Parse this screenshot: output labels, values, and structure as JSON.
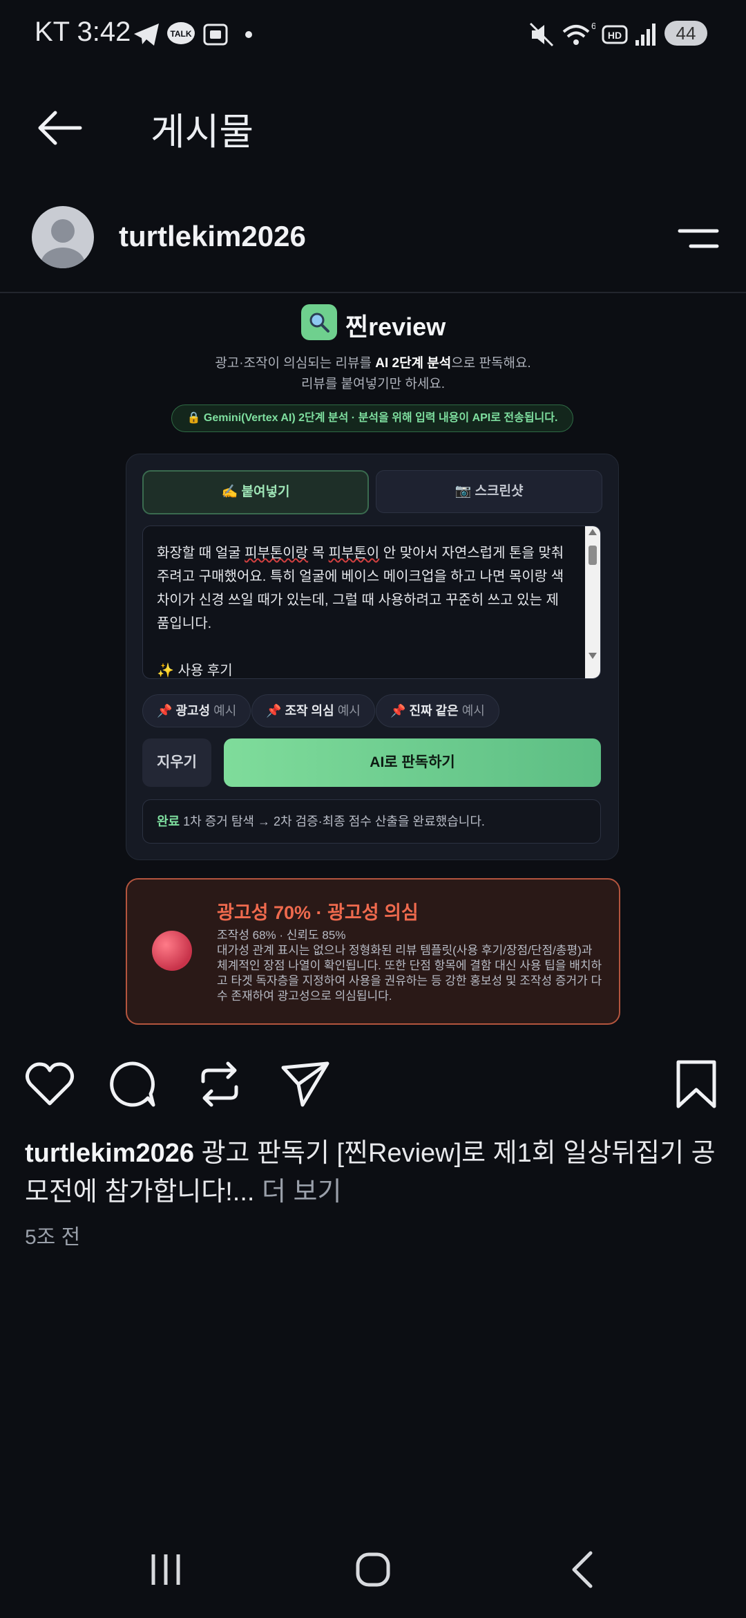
{
  "status_bar": {
    "time": "KT 3:42",
    "battery": "44"
  },
  "header": {
    "title": "게시물"
  },
  "profile": {
    "username": "turtlekim2026"
  },
  "post_image": {
    "logo": "찐review",
    "subtitle_pre": "광고·조작이 의심되는 리뷰를 ",
    "subtitle_bold": "AI 2단계 분석",
    "subtitle_post": "으로 판독해요.",
    "subtitle2": "리뷰를 붙여넣기만 하세요.",
    "notice": "🔒 Gemini(Vertex AI) 2단계 분석 · 분석을 위해 입력 내용이 API로 전송됩니다.",
    "tabs": {
      "paste": "✍️ 붙여넣기",
      "screenshot": "📷 스크린샷"
    },
    "review": {
      "p1": "화장할 때 얼굴 ",
      "w1": "피부톤이랑",
      "p2": " 목 ",
      "w2": "피부톤이",
      "p3": " 안 맞아서 자연스럽게 톤을 맞춰주려고 구매했어요. 특히 얼굴에 베이스 메이크업을 하고 나면 목이랑 색 차이가 신경 쓰일 때가 있는데, 그럴 때 사용하려고 꾸준히 쓰고 있는 제품입니다.",
      "p4": "✨ 사용 후기"
    },
    "chips": [
      {
        "label": "광고성",
        "suffix": "예시"
      },
      {
        "label": "조작 의심",
        "suffix": "예시"
      },
      {
        "label": "진짜 같은",
        "suffix": "예시"
      }
    ],
    "chip_pin": "📌",
    "clear_button": "지우기",
    "judge_button": "AI로 판독하기",
    "done_label": "완료",
    "done_text": " 1차 증거 탐색 → 2차 검증·최종 점수 산출을 완료했습니다.",
    "result": {
      "title": "광고성 70% · 광고성 의심",
      "scores": "조작성 68% · 신뢰도 85%",
      "description": "대가성 관계 표시는 없으나 정형화된 리뷰 템플릿(사용 후기/장점/단점/총평)과 체계적인 장점 나열이 확인됩니다. 또한 단점 항목에 결함 대신 사용 팁을 배치하고 타겟 독자층을 지정하여 사용을 권유하는 등 강한 홍보성 및 조작성 증거가 다수 존재하여 광고성으로 의심됩니다."
    }
  },
  "caption": {
    "username": "turtlekim2026",
    "text": " 광고 판독기 [찐Review]로 제1회 일상뒤집기 공모전에 참가합니다!...",
    "more": " 더 보기"
  },
  "time_ago": "5조 전",
  "colors": {
    "accent_green": "#7fdc9b",
    "warning": "#ef6a4e",
    "background": "#0c0e13"
  }
}
